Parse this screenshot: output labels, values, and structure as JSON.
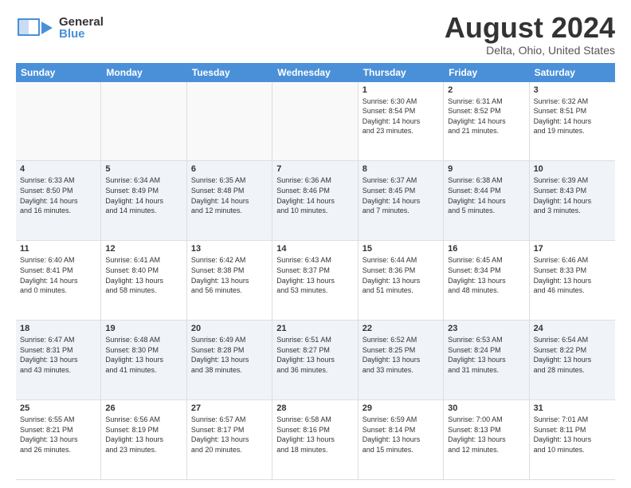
{
  "header": {
    "logo_general": "General",
    "logo_blue": "Blue",
    "month_title": "August 2024",
    "location": "Delta, Ohio, United States"
  },
  "calendar": {
    "days_of_week": [
      "Sunday",
      "Monday",
      "Tuesday",
      "Wednesday",
      "Thursday",
      "Friday",
      "Saturday"
    ],
    "weeks": [
      [
        {
          "day": "",
          "info": "",
          "empty": true
        },
        {
          "day": "",
          "info": "",
          "empty": true
        },
        {
          "day": "",
          "info": "",
          "empty": true
        },
        {
          "day": "",
          "info": "",
          "empty": true
        },
        {
          "day": "1",
          "info": "Sunrise: 6:30 AM\nSunset: 8:54 PM\nDaylight: 14 hours\nand 23 minutes.",
          "empty": false
        },
        {
          "day": "2",
          "info": "Sunrise: 6:31 AM\nSunset: 8:52 PM\nDaylight: 14 hours\nand 21 minutes.",
          "empty": false
        },
        {
          "day": "3",
          "info": "Sunrise: 6:32 AM\nSunset: 8:51 PM\nDaylight: 14 hours\nand 19 minutes.",
          "empty": false
        }
      ],
      [
        {
          "day": "4",
          "info": "Sunrise: 6:33 AM\nSunset: 8:50 PM\nDaylight: 14 hours\nand 16 minutes.",
          "empty": false
        },
        {
          "day": "5",
          "info": "Sunrise: 6:34 AM\nSunset: 8:49 PM\nDaylight: 14 hours\nand 14 minutes.",
          "empty": false
        },
        {
          "day": "6",
          "info": "Sunrise: 6:35 AM\nSunset: 8:48 PM\nDaylight: 14 hours\nand 12 minutes.",
          "empty": false
        },
        {
          "day": "7",
          "info": "Sunrise: 6:36 AM\nSunset: 8:46 PM\nDaylight: 14 hours\nand 10 minutes.",
          "empty": false
        },
        {
          "day": "8",
          "info": "Sunrise: 6:37 AM\nSunset: 8:45 PM\nDaylight: 14 hours\nand 7 minutes.",
          "empty": false
        },
        {
          "day": "9",
          "info": "Sunrise: 6:38 AM\nSunset: 8:44 PM\nDaylight: 14 hours\nand 5 minutes.",
          "empty": false
        },
        {
          "day": "10",
          "info": "Sunrise: 6:39 AM\nSunset: 8:43 PM\nDaylight: 14 hours\nand 3 minutes.",
          "empty": false
        }
      ],
      [
        {
          "day": "11",
          "info": "Sunrise: 6:40 AM\nSunset: 8:41 PM\nDaylight: 14 hours\nand 0 minutes.",
          "empty": false
        },
        {
          "day": "12",
          "info": "Sunrise: 6:41 AM\nSunset: 8:40 PM\nDaylight: 13 hours\nand 58 minutes.",
          "empty": false
        },
        {
          "day": "13",
          "info": "Sunrise: 6:42 AM\nSunset: 8:38 PM\nDaylight: 13 hours\nand 56 minutes.",
          "empty": false
        },
        {
          "day": "14",
          "info": "Sunrise: 6:43 AM\nSunset: 8:37 PM\nDaylight: 13 hours\nand 53 minutes.",
          "empty": false
        },
        {
          "day": "15",
          "info": "Sunrise: 6:44 AM\nSunset: 8:36 PM\nDaylight: 13 hours\nand 51 minutes.",
          "empty": false
        },
        {
          "day": "16",
          "info": "Sunrise: 6:45 AM\nSunset: 8:34 PM\nDaylight: 13 hours\nand 48 minutes.",
          "empty": false
        },
        {
          "day": "17",
          "info": "Sunrise: 6:46 AM\nSunset: 8:33 PM\nDaylight: 13 hours\nand 46 minutes.",
          "empty": false
        }
      ],
      [
        {
          "day": "18",
          "info": "Sunrise: 6:47 AM\nSunset: 8:31 PM\nDaylight: 13 hours\nand 43 minutes.",
          "empty": false
        },
        {
          "day": "19",
          "info": "Sunrise: 6:48 AM\nSunset: 8:30 PM\nDaylight: 13 hours\nand 41 minutes.",
          "empty": false
        },
        {
          "day": "20",
          "info": "Sunrise: 6:49 AM\nSunset: 8:28 PM\nDaylight: 13 hours\nand 38 minutes.",
          "empty": false
        },
        {
          "day": "21",
          "info": "Sunrise: 6:51 AM\nSunset: 8:27 PM\nDaylight: 13 hours\nand 36 minutes.",
          "empty": false
        },
        {
          "day": "22",
          "info": "Sunrise: 6:52 AM\nSunset: 8:25 PM\nDaylight: 13 hours\nand 33 minutes.",
          "empty": false
        },
        {
          "day": "23",
          "info": "Sunrise: 6:53 AM\nSunset: 8:24 PM\nDaylight: 13 hours\nand 31 minutes.",
          "empty": false
        },
        {
          "day": "24",
          "info": "Sunrise: 6:54 AM\nSunset: 8:22 PM\nDaylight: 13 hours\nand 28 minutes.",
          "empty": false
        }
      ],
      [
        {
          "day": "25",
          "info": "Sunrise: 6:55 AM\nSunset: 8:21 PM\nDaylight: 13 hours\nand 26 minutes.",
          "empty": false
        },
        {
          "day": "26",
          "info": "Sunrise: 6:56 AM\nSunset: 8:19 PM\nDaylight: 13 hours\nand 23 minutes.",
          "empty": false
        },
        {
          "day": "27",
          "info": "Sunrise: 6:57 AM\nSunset: 8:17 PM\nDaylight: 13 hours\nand 20 minutes.",
          "empty": false
        },
        {
          "day": "28",
          "info": "Sunrise: 6:58 AM\nSunset: 8:16 PM\nDaylight: 13 hours\nand 18 minutes.",
          "empty": false
        },
        {
          "day": "29",
          "info": "Sunrise: 6:59 AM\nSunset: 8:14 PM\nDaylight: 13 hours\nand 15 minutes.",
          "empty": false
        },
        {
          "day": "30",
          "info": "Sunrise: 7:00 AM\nSunset: 8:13 PM\nDaylight: 13 hours\nand 12 minutes.",
          "empty": false
        },
        {
          "day": "31",
          "info": "Sunrise: 7:01 AM\nSunset: 8:11 PM\nDaylight: 13 hours\nand 10 minutes.",
          "empty": false
        }
      ]
    ]
  }
}
